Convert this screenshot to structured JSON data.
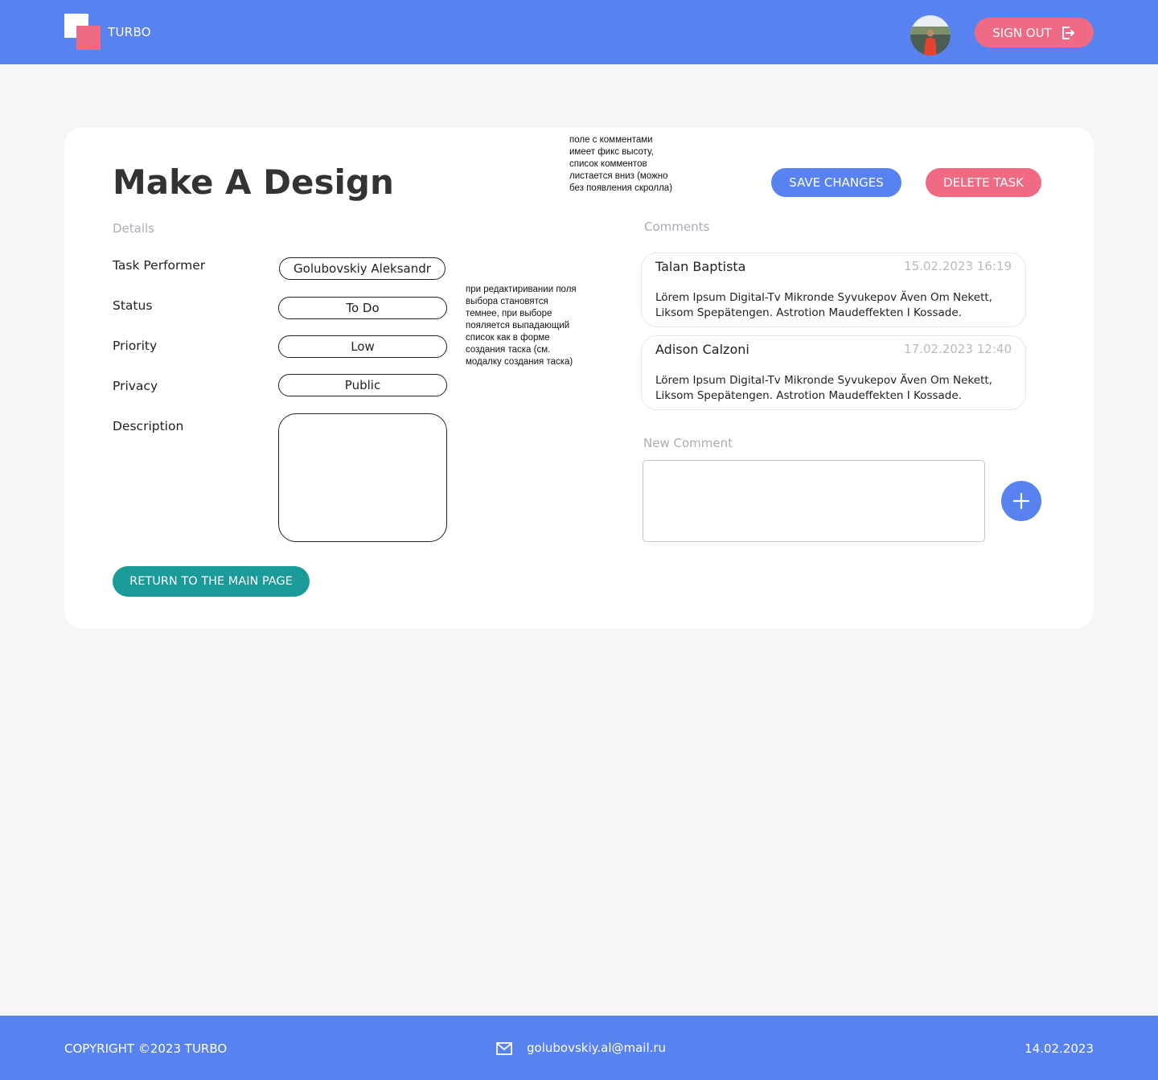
{
  "header": {
    "brand": "TURBO",
    "sign_out_label": "SIGN OUT",
    "icons": {
      "logo": "turbo-logo",
      "avatar": "user-avatar",
      "sign_out": "sign-out-icon"
    }
  },
  "task": {
    "title": "Make A Design",
    "save_label": "SAVE CHANGES",
    "delete_label": "DELETE TASK",
    "details_label": "Details",
    "fields": {
      "performer": {
        "label": "Task Performer",
        "value": "Golubovskiy Aleksandr"
      },
      "status": {
        "label": "Status",
        "value": "To Do"
      },
      "priority": {
        "label": "Priority",
        "value": "Low"
      },
      "privacy": {
        "label": "Privacy",
        "value": "Public"
      },
      "description": {
        "label": "Description",
        "value": ""
      }
    },
    "return_label": "RETURN TO THE MAIN PAGE"
  },
  "notes": {
    "comments_note": "поле с комментами\nимеет фикс высоту,\nсписок комментов\nлистается вниз (можно\nбез появления скролла)",
    "fields_note": "при редактиривании поля\nвыбора становятся\nтемнее, при выборе\nпояляется выпадающий\nсписок как в форме\nсоздания таска (см.\nмодалку создания таска)"
  },
  "comments": {
    "label": "Comments",
    "items": [
      {
        "author": "Talan Baptista",
        "time": "15.02.2023 16:19",
        "text": "Lörem Ipsum Digital-Tv Mikronde Syvukepov Även Om Nekett, Liksom Spepätengen. Astrotion Maudeffekten I Kossade."
      },
      {
        "author": "Adison Calzoni",
        "time": "17.02.2023 12:40",
        "text": "Lörem Ipsum Digital-Tv Mikronde Syvukepov Även Om Nekett, Liksom Spepätengen. Astrotion Maudeffekten I Kossade."
      }
    ],
    "new_label": "New Comment",
    "new_value": "",
    "add_icon": "plus-icon"
  },
  "footer": {
    "copyright": "COPYRIGHT ©2023 TURBO",
    "email": "golubovskiy.al@mail.ru",
    "date": "14.02.2023",
    "mail_icon": "mail-icon"
  },
  "colors": {
    "primary": "#5882f0",
    "danger": "#ef6b84",
    "teal": "#1a9a99",
    "background": "#f5f6f8"
  }
}
